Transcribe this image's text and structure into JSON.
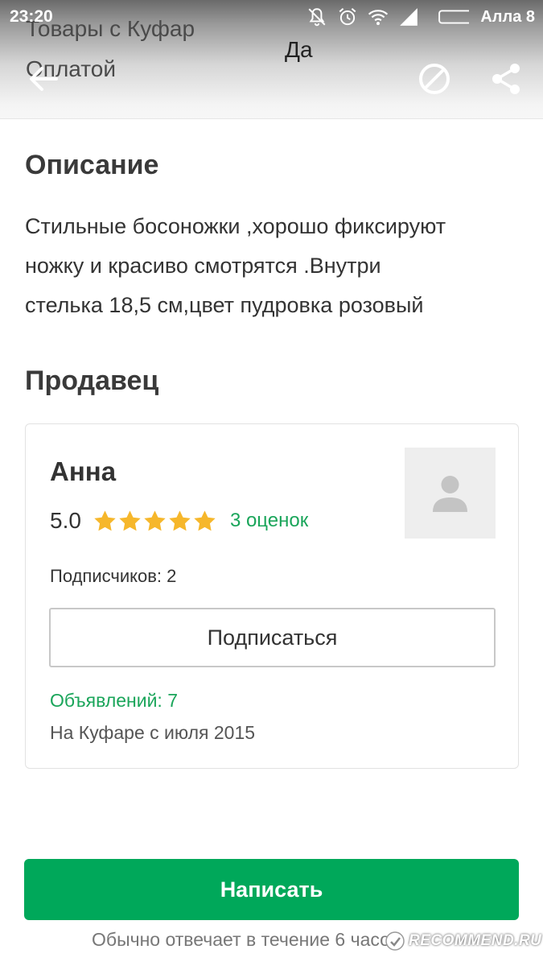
{
  "status_bar": {
    "time": "23:20",
    "carrier": "Алла 8",
    "icons": [
      "mute-bell-icon",
      "alarm-icon",
      "wifi-icon",
      "signal-icon",
      "battery-icon"
    ]
  },
  "background": {
    "line1": "Товары с Куфар",
    "line2": "Оплатой",
    "center": "Да"
  },
  "toolbar": {
    "back_icon": "arrow-left-icon",
    "block_icon": "block-icon",
    "share_icon": "share-icon"
  },
  "description": {
    "title": "Описание",
    "text": "Стильные босоножки ,хорошо фиксируют\nножку и красиво смотрятся  .Внутри\nстелька 18,5 см,цвет пудровка розовый"
  },
  "seller": {
    "section_title": "Продавец",
    "name": "Анна",
    "rating_value": "5.0",
    "stars": 5,
    "ratings_count": "3 оценок",
    "subscribers": "Подписчиков: 2",
    "subscribe_label": "Подписаться",
    "ads": "Объявлений: 7",
    "since": "На Куфаре с июля 2015",
    "avatar_icon": "user-placeholder-icon"
  },
  "write_label": "Написать",
  "reply_note": "Обычно отвечает в течение 6 часов",
  "watermark": "RECOMMEND.RU",
  "colors": {
    "accent": "#00a85a",
    "link": "#1aa55a",
    "star": "#f6b72b",
    "text": "#333333"
  }
}
